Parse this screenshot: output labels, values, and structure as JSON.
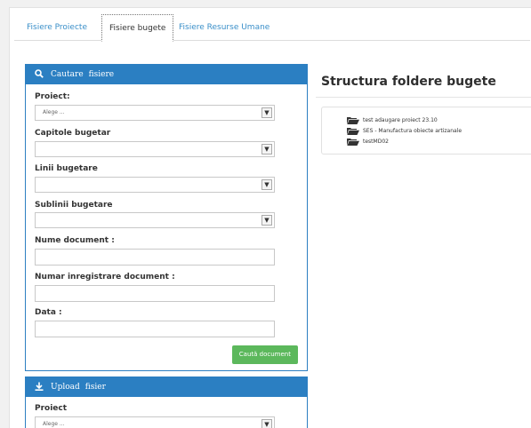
{
  "tabs": [
    {
      "label": "Fisiere Proiecte"
    },
    {
      "label": "Fisiere bugete"
    },
    {
      "label": "Fisiere Resurse Umane"
    }
  ],
  "search_panel": {
    "title_word1": "Cautare",
    "title_word2": "fisiere",
    "fields": {
      "proiect_label": "Proiect:",
      "proiect_value": "Alege ...",
      "capitole_label": "Capitole bugetar",
      "linii_label": "Linii bugetare",
      "sublinii_label": "Sublinii bugetare",
      "nume_label": "Nume document :",
      "numar_label": "Numar inregistrare document :",
      "data_label": "Data :"
    },
    "button_label": "Caută document"
  },
  "upload_panel": {
    "title_word1": "Upload",
    "title_word2": "fisier",
    "proiect_label": "Proiect",
    "proiect_value": "Alege ..."
  },
  "structure": {
    "title": "Structura foldere bugete",
    "folders": [
      {
        "name": "test adaugare proiect 23.10"
      },
      {
        "name": "SES - Manufactura obiecte artizanale"
      },
      {
        "name": "testMD02"
      }
    ]
  },
  "colors": {
    "panel_header": "#2b7fc2",
    "button_green": "#5cb85c",
    "tab_link": "#3a8fc9"
  }
}
